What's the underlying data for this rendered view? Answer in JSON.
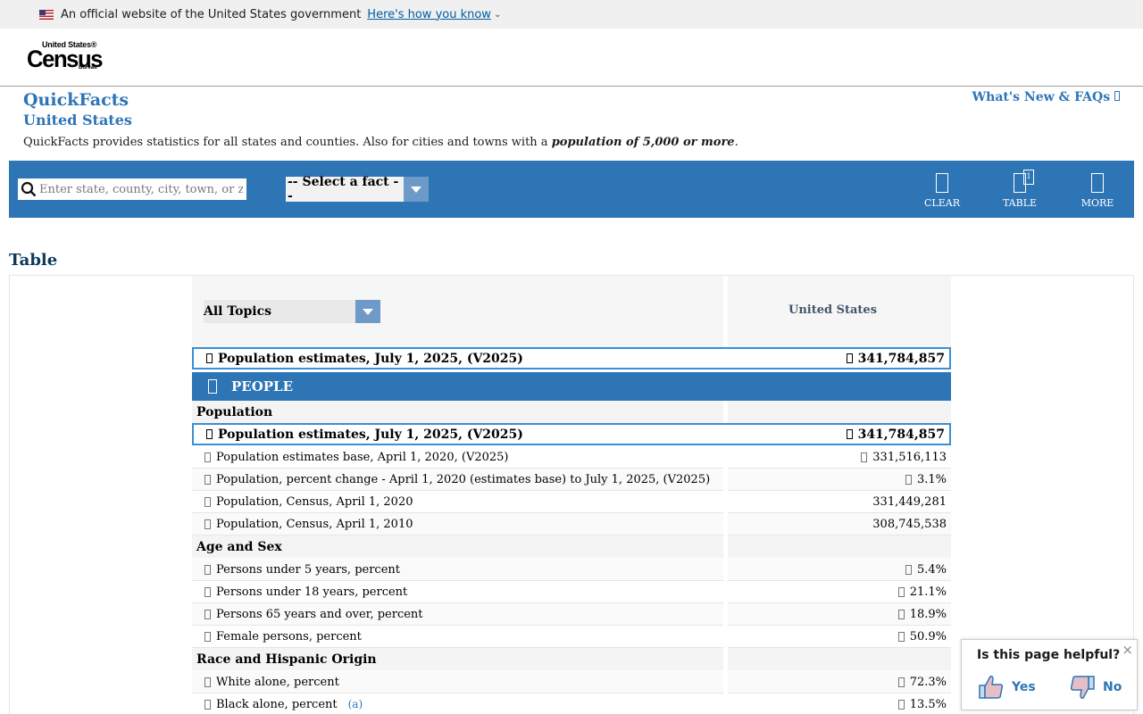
{
  "gov_banner": {
    "text": "An official website of the United States government",
    "link": "Here's how you know"
  },
  "logo": {
    "top": "United States®",
    "main": "Census",
    "sub": "Bureau"
  },
  "header": {
    "title": "QuickFacts",
    "subtitle": "United States",
    "whats_new": "What's New & FAQs",
    "description_pre": "QuickFacts provides statistics for all states and counties. Also for cities and towns with a ",
    "description_bold": "population of 5,000 or more",
    "description_post": "."
  },
  "toolbar": {
    "search_placeholder": "Enter state, county, city, town, or zip code",
    "fact_select": "-- Select a fact --",
    "clear": "CLEAR",
    "table": "TABLE",
    "table_badge": "1",
    "more": "MORE"
  },
  "table": {
    "heading": "Table",
    "topic_select": "All Topics",
    "geo_header": "United States",
    "highlight": {
      "label": "Population estimates, July 1, 2025, (V2025)",
      "value": "341,784,857"
    },
    "section": "PEOPLE",
    "groups": [
      {
        "name": "Population",
        "rows": [
          {
            "label": "Population estimates, July 1, 2025, (V2025)",
            "value": "341,784,857"
          },
          {
            "label": "Population estimates base, April 1, 2020, (V2025)",
            "value": "331,516,113"
          },
          {
            "label": "Population, percent change - April 1, 2020 (estimates base) to July 1, 2025, (V2025)",
            "value": "3.1%"
          },
          {
            "label": "Population, Census, April 1, 2020",
            "value": "331,449,281"
          },
          {
            "label": "Population, Census, April 1, 2010",
            "value": "308,745,538"
          }
        ]
      },
      {
        "name": "Age and Sex",
        "rows": [
          {
            "label": "Persons under 5 years, percent",
            "value": "5.4%"
          },
          {
            "label": "Persons under 18 years, percent",
            "value": "21.1%"
          },
          {
            "label": "Persons 65 years and over, percent",
            "value": "18.9%"
          },
          {
            "label": "Female persons, percent",
            "value": "50.9%"
          }
        ]
      },
      {
        "name": "Race and Hispanic Origin",
        "rows": [
          {
            "label": "White alone, percent",
            "value": "72.3%"
          },
          {
            "label": "Black alone, percent",
            "value": "13.5%",
            "footnote": "(a)"
          }
        ]
      }
    ]
  },
  "feedback": {
    "question": "Is this page helpful?",
    "yes": "Yes",
    "no": "No"
  },
  "colors": {
    "brand_blue": "#2e75b6",
    "select_arrow": "#6d9ac9",
    "gov_link": "#005ea2"
  }
}
